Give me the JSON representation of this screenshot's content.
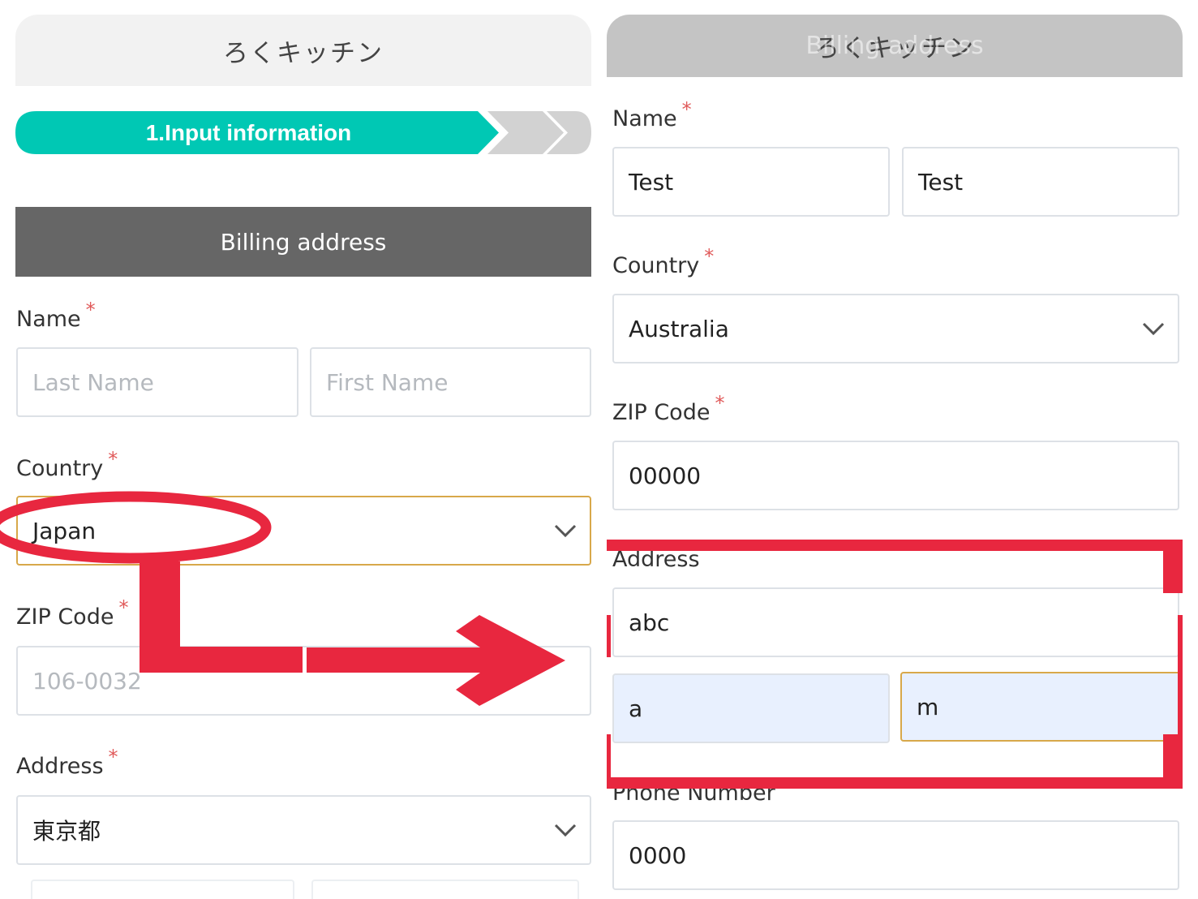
{
  "left_panel": {
    "header_title": "ろくキッチン",
    "progress": {
      "step1_label": "1.Input information"
    },
    "section_title": "Billing address",
    "name": {
      "label": "Name",
      "required_mark": "*",
      "last_placeholder": "Last Name",
      "first_placeholder": "First Name"
    },
    "country": {
      "label": "Country",
      "required_mark": "*",
      "value": "Japan"
    },
    "zip": {
      "label": "ZIP Code",
      "required_mark": "*",
      "placeholder": "106-0032"
    },
    "address": {
      "label": "Address",
      "required_mark": "*",
      "value": "東京都"
    }
  },
  "right_panel": {
    "header_title": "ろくキッチン",
    "header_overlap_text": "Billing address",
    "name": {
      "label": "Name",
      "required_mark": "*",
      "last_value": "Test",
      "first_value": "Test"
    },
    "country": {
      "label": "Country",
      "required_mark": "*",
      "value": "Australia"
    },
    "zip": {
      "label": "ZIP Code",
      "required_mark": "*",
      "value": "00000"
    },
    "address": {
      "label": "Address",
      "required_mark": "*",
      "line1_value": "abc",
      "line2a_value": "a",
      "line2b_value": "m"
    },
    "phone": {
      "label": "Phone Number",
      "value": "0000"
    }
  },
  "colors": {
    "progress_active": "#00c8b4",
    "progress_inactive": "#d2d2d2",
    "section_bar": "#666666",
    "required_star": "#e05a5a",
    "annotation_red": "#e8273f",
    "focus_border": "#d8a84a",
    "autofill_bg": "#e8f0fe"
  }
}
